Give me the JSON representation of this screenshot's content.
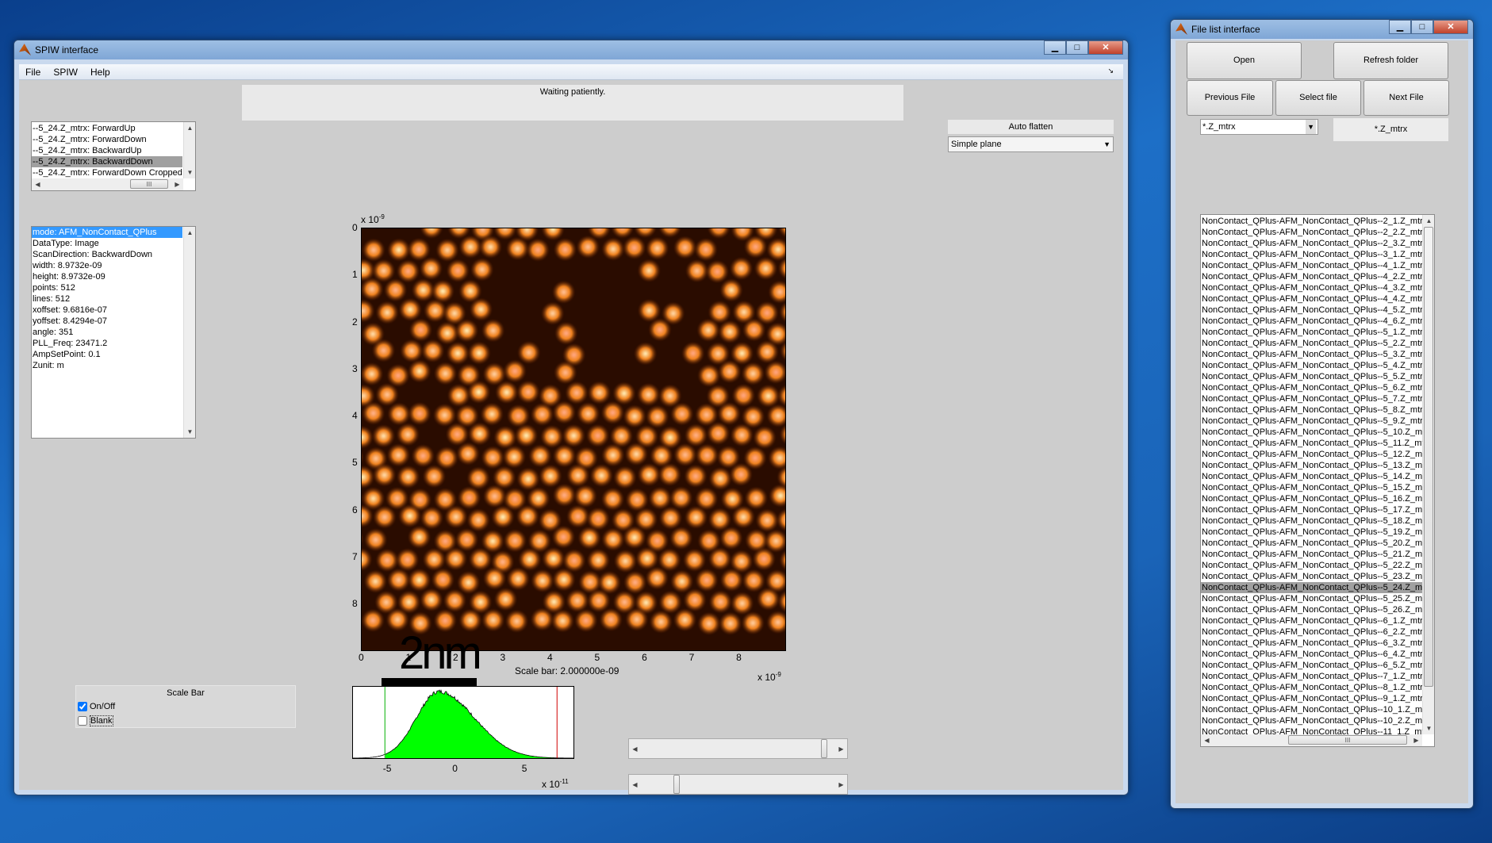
{
  "spiw": {
    "title": "SPIW interface",
    "menu": [
      "File",
      "SPIW",
      "Help"
    ],
    "status": "Waiting patiently.",
    "channels": {
      "items": [
        "--5_24.Z_mtrx: ForwardUp",
        "--5_24.Z_mtrx: ForwardDown",
        "--5_24.Z_mtrx: BackwardUp",
        "--5_24.Z_mtrx: BackwardDown",
        "--5_24.Z_mtrx: ForwardDown Cropped"
      ],
      "selected": 3
    },
    "info": {
      "items": [
        "mode: AFM_NonContact_QPlus",
        "DataType: Image",
        "ScanDirection: BackwardDown",
        "width: 8.9732e-09",
        "height: 8.9732e-09",
        "points: 512",
        "lines: 512",
        "xoffset: 9.6816e-07",
        "yoffset: 8.4294e-07",
        "angle: 351",
        "PLL_Freq: 23471.2",
        "AmpSetPoint: 0.1",
        "Zunit: m"
      ],
      "selected": 0
    },
    "flatten": {
      "label": "Auto flatten",
      "value": "Simple plane"
    },
    "image": {
      "y_ticks": [
        "0",
        "1",
        "2",
        "3",
        "4",
        "5",
        "6",
        "7",
        "8"
      ],
      "x_ticks": [
        "0",
        "1",
        "2",
        "3",
        "4",
        "5",
        "6",
        "7",
        "8"
      ],
      "y_exp": "x 10",
      "x_exp": "x 10",
      "exp": "-9",
      "range_max": 8.9732,
      "scalebar_text": "2nm",
      "scalebar_caption": "Scale bar: 2.000000e-09",
      "colormap": "afmhot"
    },
    "scalebar_panel": {
      "title": "Scale Bar",
      "onoff": "On/Off",
      "onoff_checked": true,
      "blank": "Blank",
      "blank_checked": false
    },
    "histogram": {
      "ticks": [
        "-5",
        "0",
        "5"
      ],
      "exp_base": "x 10",
      "exp": "-11",
      "low_cut": -5.2,
      "high_cut": 7.2,
      "xlim": [
        -7.5,
        8.5
      ],
      "fill": "#00ff00"
    },
    "sliders": [
      {
        "value": 0.95
      },
      {
        "value": 0.17
      }
    ]
  },
  "filelist": {
    "title": "File list interface",
    "buttons": {
      "open": "Open",
      "refresh": "Refresh folder",
      "previous": "Previous File",
      "select": "Select file",
      "next": "Next File"
    },
    "filter_dropdown": "*.Z_mtrx",
    "filter_text": "*.Z_mtrx",
    "prefix": "NonContact_QPlus-AFM_NonContact_QPlus--",
    "files": [
      "2_1",
      "2_2",
      "2_3",
      "3_1",
      "4_1",
      "4_2",
      "4_3",
      "4_4",
      "4_5",
      "4_6",
      "5_1",
      "5_2",
      "5_3",
      "5_4",
      "5_5",
      "5_6",
      "5_7",
      "5_8",
      "5_9",
      "5_10",
      "5_11",
      "5_12",
      "5_13",
      "5_14",
      "5_15",
      "5_16",
      "5_17",
      "5_18",
      "5_19",
      "5_20",
      "5_21",
      "5_22",
      "5_23",
      "5_24",
      "5_25",
      "5_26",
      "6_1",
      "6_2",
      "6_3",
      "6_4",
      "6_5",
      "7_1",
      "8_1",
      "9_1",
      "10_1",
      "10_2",
      "11_1"
    ],
    "suffix": ".Z_mtrx",
    "selected": "5_24"
  }
}
